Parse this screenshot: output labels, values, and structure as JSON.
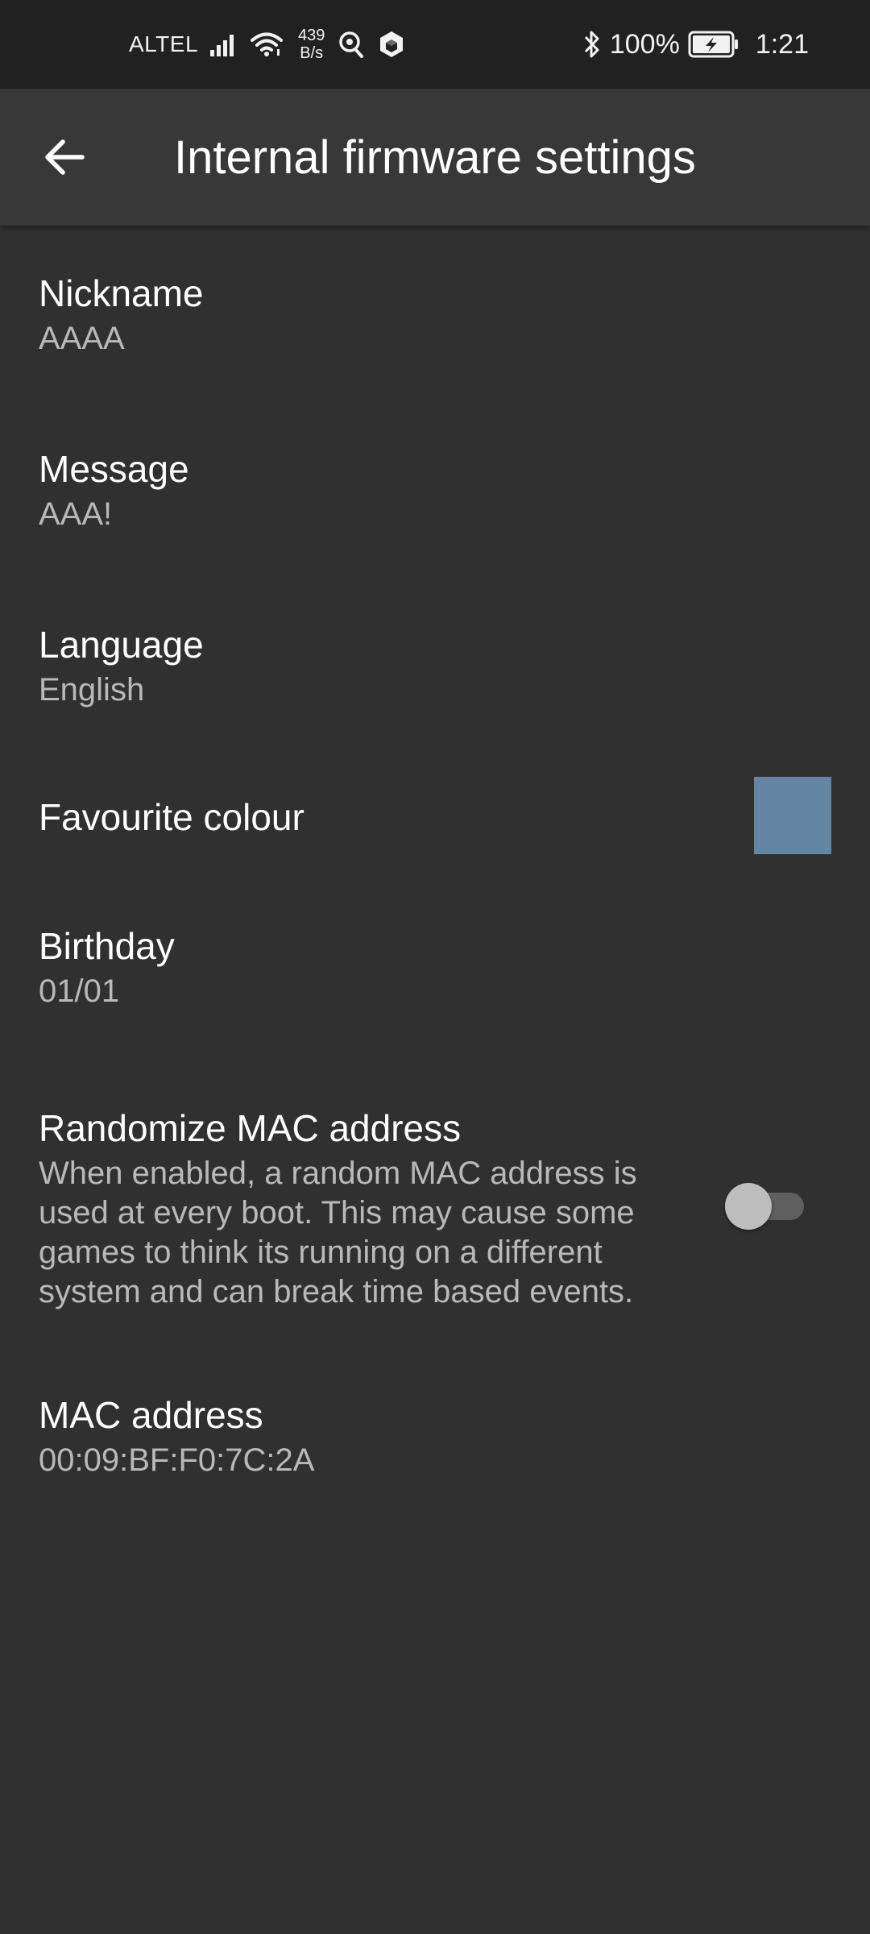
{
  "status_bar": {
    "carrier": "ALTEL",
    "net_speed_value": "439",
    "net_speed_unit": "B/s",
    "battery_percent": "100%",
    "time": "1:21",
    "icons": [
      "signal-icon",
      "wifi-icon",
      "location-icon",
      "cube-icon",
      "bluetooth-icon",
      "battery-charging-icon"
    ]
  },
  "app_bar": {
    "title": "Internal firmware settings",
    "back_icon": "back-arrow-icon"
  },
  "preferences": {
    "nickname": {
      "title": "Nickname",
      "summary": "AAAA"
    },
    "message": {
      "title": "Message",
      "summary": "AAA!"
    },
    "language": {
      "title": "Language",
      "summary": "English"
    },
    "favourite_colour": {
      "title": "Favourite colour",
      "color": "#6486a2"
    },
    "birthday": {
      "title": "Birthday",
      "summary": "01/01"
    },
    "randomize_mac": {
      "title": "Randomize MAC address",
      "summary_lines": [
        "When enabled, a random MAC address is",
        "used at every boot. This may cause some",
        "games to think its running on a different",
        "system and can break time based events."
      ],
      "enabled": false
    },
    "mac_address": {
      "title": "MAC address",
      "summary": "00:09:BF:F0:7C:2A"
    }
  }
}
